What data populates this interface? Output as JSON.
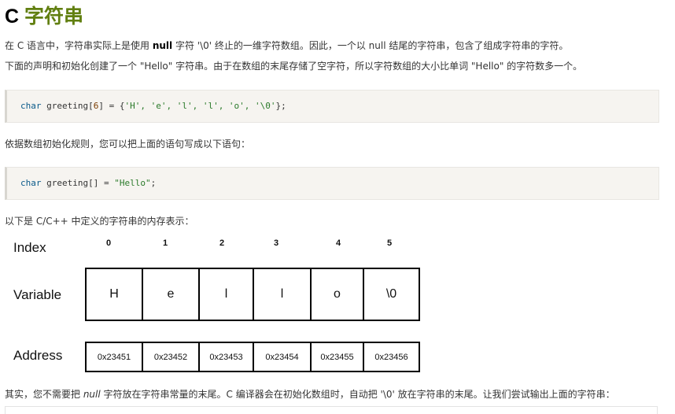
{
  "title": {
    "prefix": "C",
    "accent": "字符串"
  },
  "p1": {
    "a": "在 C 语言中，字符串实际上是使用 ",
    "b": "null",
    "c": " 字符 '\\0' 终止的一维字符数组。因此，一个以 null 结尾的字符串，包含了组成字符串的字符。"
  },
  "p2": "下面的声明和初始化创建了一个 \"Hello\" 字符串。由于在数组的末尾存储了空字符，所以字符数组的大小比单词 \"Hello\" 的字符数多一个。",
  "code1": {
    "kw": "char",
    "id": " greeting[",
    "num": "6",
    "rest": "] = {",
    "vals": "'H', 'e', 'l', 'l', 'o', '\\0'",
    "end": "};"
  },
  "p3": "依据数组初始化规则，您可以把上面的语句写成以下语句：",
  "code2": {
    "kw": "char",
    "id": " greeting[] = ",
    "str": "\"Hello\"",
    "end": ";"
  },
  "p4": "以下是 C/C++ 中定义的字符串的内存表示：",
  "diagram": {
    "index_label": "Index",
    "variable_label": "Variable",
    "address_label": "Address",
    "indices": [
      "0",
      "1",
      "2",
      "3",
      "4",
      "5"
    ],
    "variables": [
      "H",
      "e",
      "l",
      "l",
      "o",
      "\\0"
    ],
    "addresses": [
      "0x23451",
      "0x23452",
      "0x23453",
      "0x23454",
      "0x23455",
      "0x23456"
    ]
  },
  "p5": {
    "a": "其实，您不需要把 ",
    "b": "null",
    "c": " 字符放在字符串常量的末尾。C 编译器会在初始化数组时，自动把 '\\0' 放在字符串的末尾。让我们尝试输出上面的字符串："
  }
}
